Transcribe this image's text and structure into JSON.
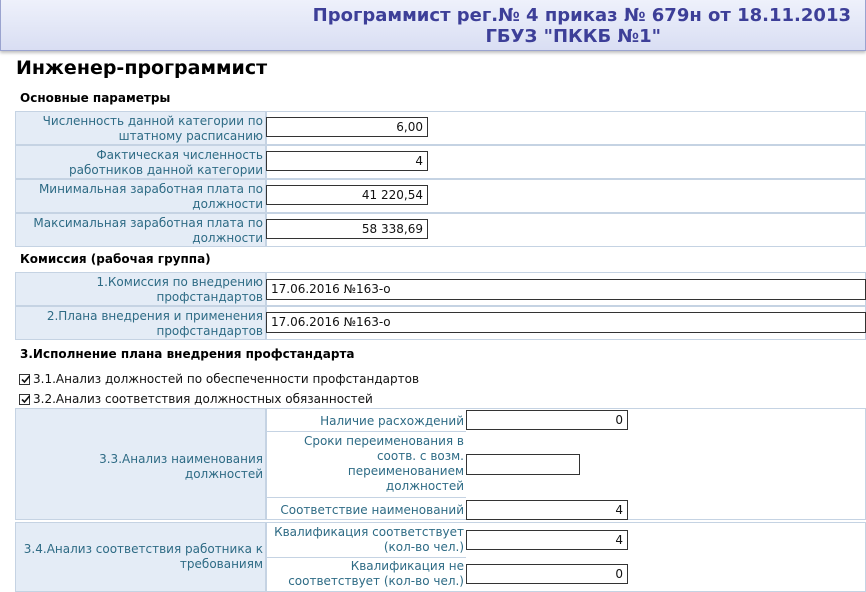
{
  "header": {
    "line1": "Программист рег.№ 4 приказ № 679н от 18.11.2013",
    "line2": "ГБУЗ \"ПККБ №1\""
  },
  "page_title": "Инженер-программист",
  "sections": {
    "basic": {
      "title": "Основные параметры",
      "fields": [
        {
          "label": "Численность данной категории по штатному расписанию",
          "value": "6,00"
        },
        {
          "label": "Фактическая численность работников данной категории",
          "value": "4"
        },
        {
          "label": "Минимальная заработная плата по должности",
          "value": "41 220,54"
        },
        {
          "label": "Максимальная заработная плата по должности",
          "value": "58 338,69"
        }
      ]
    },
    "commission": {
      "title": "Комиссия (рабочая группа)",
      "fields": [
        {
          "label": "1.Комиссия по внедрению профстандартов",
          "value": "17.06.2016 №163-о"
        },
        {
          "label": "2.Плана внедрения и применения профстандартов",
          "value": "17.06.2016 №163-о"
        }
      ]
    },
    "execution": {
      "title": "3.Исполнение плана внедрения профстандарта",
      "checks": [
        {
          "label": "3.1.Анализ должностей по обеспеченности профстандартов",
          "checked": true
        },
        {
          "label": "3.2.Анализ соответствия должностных обязанностей",
          "checked": true
        }
      ],
      "group33": {
        "label": "3.3.Анализ наименования должностей",
        "rows": [
          {
            "label": "Наличие расхождений",
            "value": "0"
          },
          {
            "label": "Сроки переименования в соотв. с возм. переименованием должностей",
            "value": ""
          },
          {
            "label": "Соответствие наименований",
            "value": "4"
          }
        ]
      },
      "group34": {
        "label": "3.4.Анализ соответствия работника к требованиям",
        "rows": [
          {
            "label": "Квалификация соответствует (кол-во чел.)",
            "value": "4"
          },
          {
            "label": "Квалификация не соответствует (кол-во чел.)",
            "value": "0"
          }
        ]
      }
    }
  }
}
